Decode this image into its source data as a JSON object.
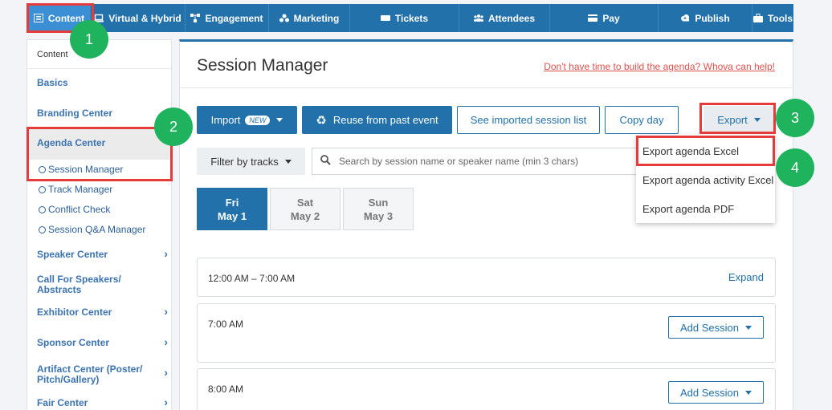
{
  "nav": {
    "items": [
      {
        "label": "Content",
        "icon": "list-icon"
      },
      {
        "label": "Virtual & Hybrid",
        "icon": "laptop-icon"
      },
      {
        "label": "Engagement",
        "icon": "network-icon"
      },
      {
        "label": "Marketing",
        "icon": "users-circle-icon"
      },
      {
        "label": "Tickets",
        "icon": "ticket-icon"
      },
      {
        "label": "Attendees",
        "icon": "attendees-icon"
      },
      {
        "label": "Pay",
        "icon": "card-icon"
      },
      {
        "label": "Publish",
        "icon": "cloud-upload-icon"
      },
      {
        "label": "Tools",
        "icon": "briefcase-icon"
      }
    ]
  },
  "sidebar": {
    "header": "Content",
    "basics": "Basics",
    "branding": "Branding Center",
    "agenda": "Agenda Center",
    "sub": [
      "Session Manager",
      "Track Manager",
      "Conflict Check",
      "Session Q&A Manager"
    ],
    "speaker": "Speaker Center",
    "cfs_line1": "Call For Speakers/",
    "cfs_line2": "Abstracts",
    "exhibitor": "Exhibitor Center",
    "sponsor": "Sponsor Center",
    "artifact_line1": "Artifact Center (Poster/",
    "artifact_line2": "Pitch/Gallery)",
    "fair": "Fair Center"
  },
  "main": {
    "title": "Session Manager",
    "help_link": "Don't have time to build the agenda? Whova can help!",
    "import_label": "Import",
    "new_badge": "NEW",
    "reuse_label": "Reuse from past event",
    "see_imported_label": "See imported session list",
    "copy_day_label": "Copy day",
    "export_label": "Export",
    "filter_label": "Filter by tracks",
    "search_placeholder": "Search by session name or speaker name (min 3 chars)",
    "days": [
      {
        "dow": "Fri",
        "date": "May 1"
      },
      {
        "dow": "Sat",
        "date": "May 2"
      },
      {
        "dow": "Sun",
        "date": "May 3"
      }
    ],
    "slots": [
      {
        "time": "12:00 AM – 7:00 AM",
        "action": "Expand"
      },
      {
        "time": "7:00 AM",
        "action": "Add Session"
      },
      {
        "time": "8:00 AM",
        "action": "Add Session"
      }
    ]
  },
  "export_menu": [
    "Export agenda Excel",
    "Export agenda activity Excel",
    "Export agenda PDF"
  ],
  "markers": [
    "1",
    "2",
    "3",
    "4"
  ],
  "colors": {
    "brand": "#2271ab",
    "highlight": "#e53b3b",
    "marker": "#1fb35d"
  }
}
